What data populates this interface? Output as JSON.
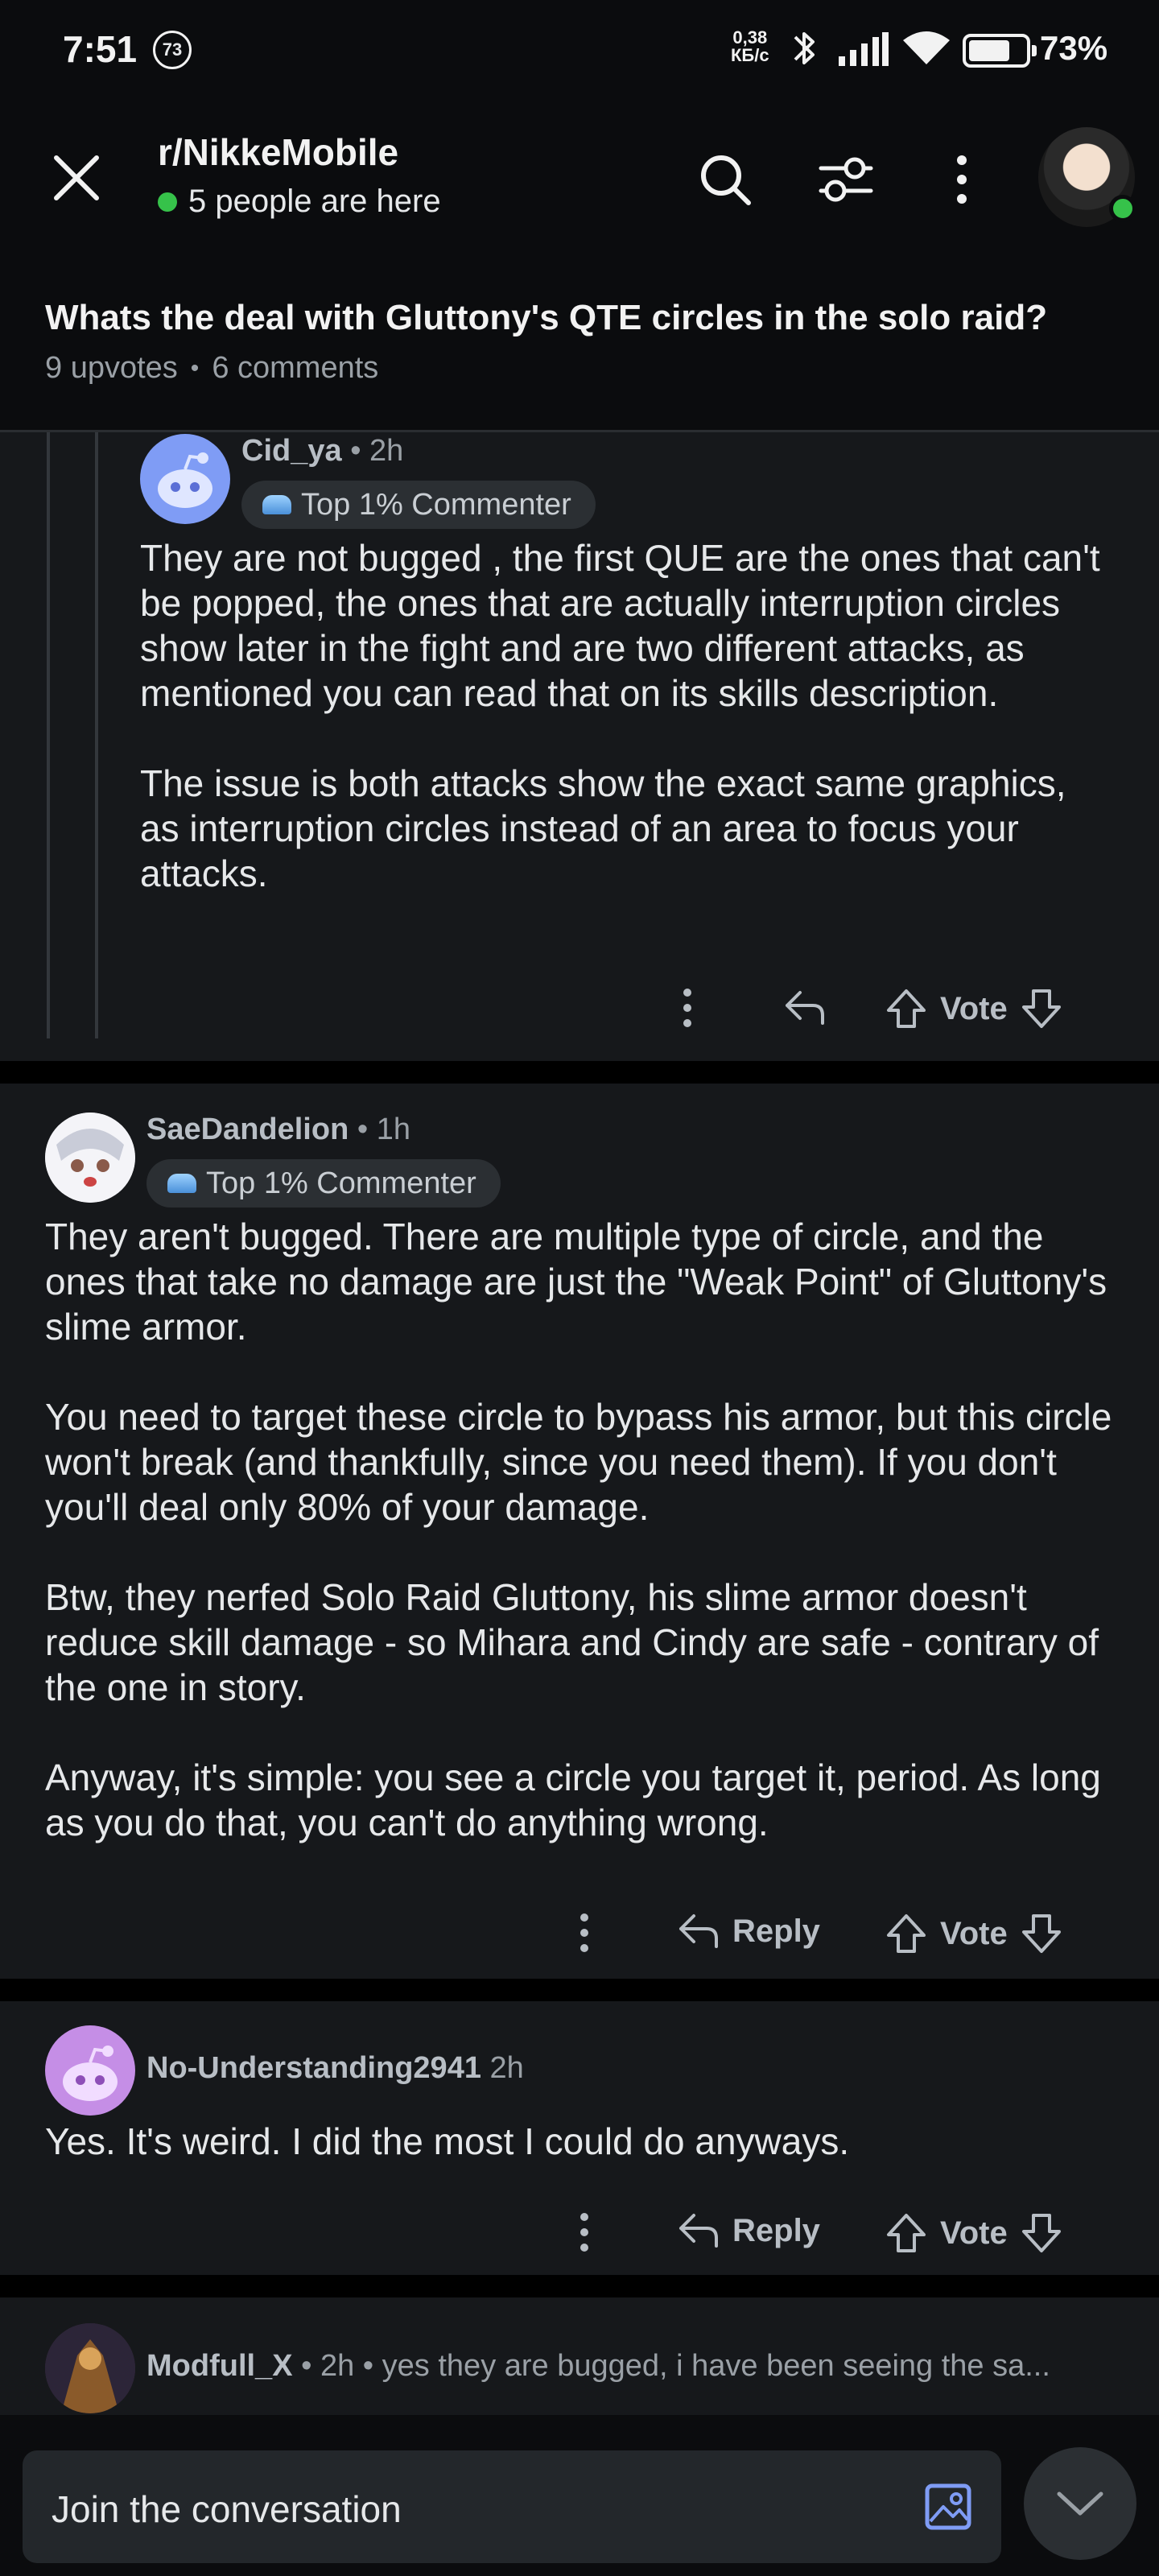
{
  "status_bar": {
    "time": "7:51",
    "notification_count": "73",
    "network_speed": "0,38",
    "network_unit": "КБ/с",
    "battery_percent": "73%",
    "battery_level": 0.73
  },
  "header": {
    "subreddit": "r/NikkeMobile",
    "online_text": "5 people are here"
  },
  "post": {
    "title": "Whats the deal with Gluttony's QTE circles in the solo raid?",
    "upvotes": "9 upvotes",
    "separator": "•",
    "comments": "6 comments"
  },
  "comments": [
    {
      "user": "Cid_ya",
      "time": "• 2h",
      "badge": "Top 1% Commenter",
      "paragraphs": [
        "They are not bugged , the first QUE are the ones that can't be popped, the ones that are actually interruption circles show later in the fight and are two different attacks, as mentioned you can read that on its skills description.",
        "The issue is both attacks show the exact same graphics, as interruption circles instead of an area to focus your attacks."
      ],
      "vote_label": "Vote"
    },
    {
      "user": "SaeDandelion",
      "time": "• 1h",
      "badge": "Top 1% Commenter",
      "paragraphs": [
        "They aren't bugged. There are multiple type of circle, and the ones that take no damage are just the \"Weak Point\" of Gluttony's slime armor.",
        "You need to target these circle to bypass his armor, but this circle won't break (and thankfully, since you need them). If you don't you'll deal only 80% of your damage.",
        "Btw, they nerfed Solo Raid Gluttony, his slime armor doesn't reduce skill damage - so Mihara and Cindy are safe - contrary of the one in story.",
        "Anyway, it's simple: you see a circle you target it, period. As long as you do that, you can't do anything wrong."
      ],
      "reply_label": "Reply",
      "vote_label": "Vote"
    },
    {
      "user": "No-Understanding2941",
      "time": "2h",
      "paragraphs": [
        "Yes. It's weird. I did the most I could do anyways."
      ],
      "reply_label": "Reply",
      "vote_label": "Vote"
    },
    {
      "user": "Modfull_X",
      "time": "• 2h •",
      "preview": "yes they are bugged, i have been seeing the sa..."
    }
  ],
  "composer": {
    "placeholder": "Join the conversation"
  }
}
